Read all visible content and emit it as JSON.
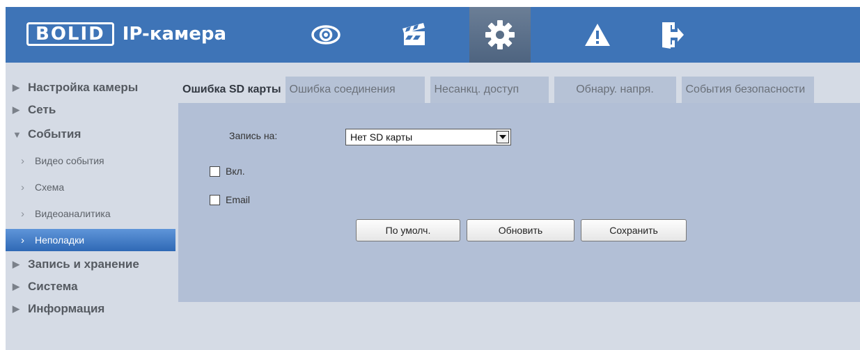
{
  "header": {
    "logo_brand": "BOLID",
    "logo_product": "IP-камера",
    "nav_icons": [
      "eye-icon",
      "clapperboard-icon",
      "gear-icon",
      "warning-icon",
      "logout-icon"
    ],
    "active_icon": "gear-icon"
  },
  "sidebar": {
    "items": [
      {
        "label": "Настройка камеры",
        "expanded": false
      },
      {
        "label": "Сеть",
        "expanded": false
      },
      {
        "label": "События",
        "expanded": true
      },
      {
        "label": "Запись и хранение",
        "expanded": false
      },
      {
        "label": "Система",
        "expanded": false
      },
      {
        "label": "Информация",
        "expanded": false
      }
    ],
    "sub_items": [
      {
        "label": "Видео события"
      },
      {
        "label": "Схема"
      },
      {
        "label": "Видеоаналитика"
      },
      {
        "label": "Неполадки",
        "active": true
      }
    ]
  },
  "tabs": [
    {
      "label": "Ошибка SD карты",
      "active": true
    },
    {
      "label": "Ошибка соединения"
    },
    {
      "label": "Несанкц. доступ"
    },
    {
      "label": "Обнару. напря."
    },
    {
      "label": "События безопасности"
    }
  ],
  "form": {
    "record_label": "Запись на:",
    "record_value": "Нет SD карты",
    "enable_label": "Вкл.",
    "enable_checked": false,
    "email_label": "Email",
    "email_checked": false
  },
  "buttons": {
    "default": "По умолч.",
    "refresh": "Обновить",
    "save": "Сохранить"
  },
  "colors": {
    "header": "#3e74b7",
    "active_item": "#2f69b5",
    "panel": "#b2bfd6",
    "background": "#d5dbe5"
  }
}
